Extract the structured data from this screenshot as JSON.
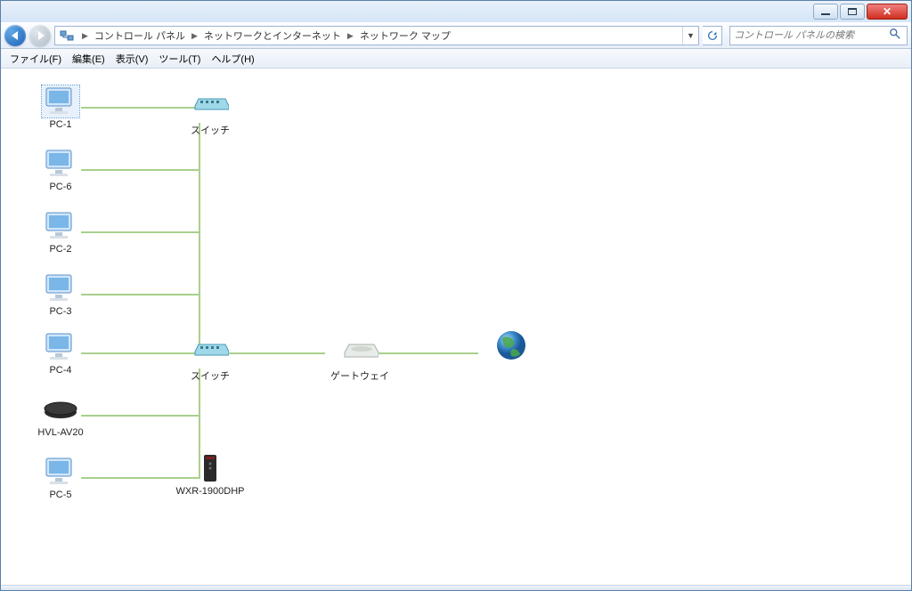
{
  "breadcrumb": {
    "root": "コントロール パネル",
    "mid": "ネットワークとインターネット",
    "leaf": "ネットワーク マップ"
  },
  "search": {
    "placeholder": "コントロール パネルの検索"
  },
  "menu": {
    "file": "ファイル(F)",
    "edit": "編集(E)",
    "view": "表示(V)",
    "tools": "ツール(T)",
    "help": "ヘルプ(H)"
  },
  "nodes": {
    "pc1": "PC-1",
    "pc6": "PC-6",
    "pc2": "PC-2",
    "pc3": "PC-3",
    "pc4": "PC-4",
    "hvl": "HVL-AV20",
    "pc5": "PC-5",
    "switch1": "スイッチ",
    "switch2": "スイッチ",
    "wxr": "WXR-1900DHP",
    "gateway": "ゲートウェイ"
  }
}
